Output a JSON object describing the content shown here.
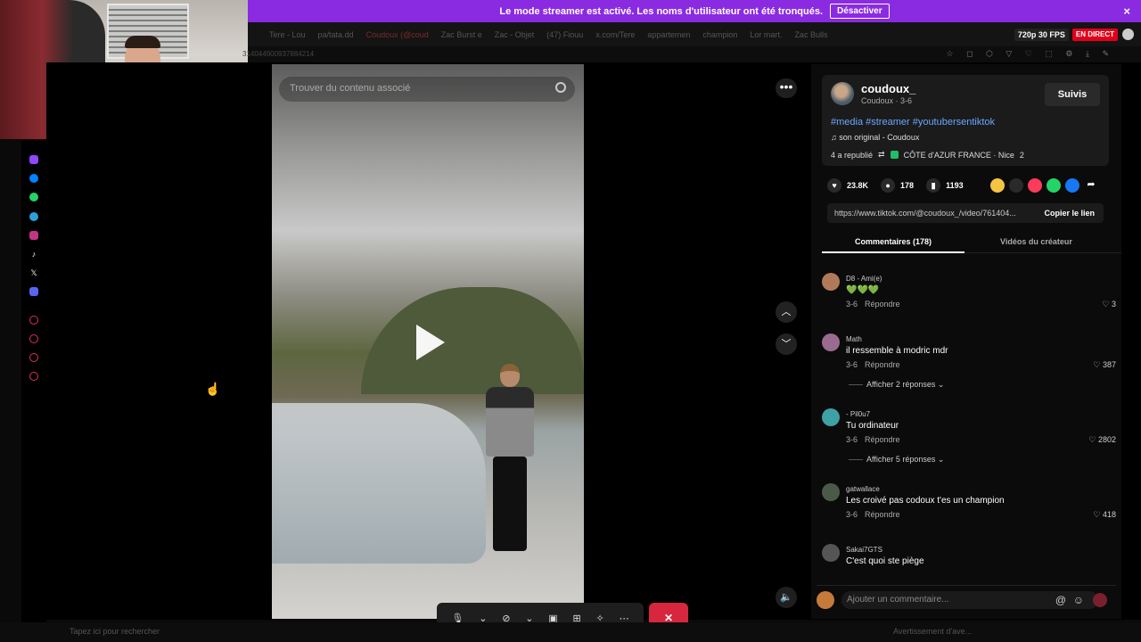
{
  "banner": {
    "message": "Le mode streamer est activé. Les noms d'utilisateur ont été tronqués.",
    "disable_label": "Désactiver",
    "close": "×"
  },
  "stream": {
    "resolution": "720p 30 FPS",
    "live_label": "EN DIRECT"
  },
  "browser": {
    "tabs": [
      "Tere - Lou",
      "pa/tata.dd",
      "Coudoux (@coud",
      "Zac Burst e",
      "Zac - Objet",
      "(47) Fiouu",
      "x.com/Tere",
      "appartemen",
      "champion",
      "Lor mart.",
      "Zac Bulls"
    ],
    "url_fragment": "314044900937884214"
  },
  "video": {
    "search_placeholder": "Trouver du contenu associé"
  },
  "post": {
    "username": "coudoux_",
    "display": "Coudoux · 3-6",
    "follow_label": "Suivis",
    "hashtags": "#media #streamer #youtubersentiktok",
    "music": "son original - Coudoux",
    "reposts": "4 a republié",
    "location": "CÔTE d'AZUR FRANCE · Nice",
    "location_more": "2",
    "likes": "23.8K",
    "comments": "178",
    "saves": "1193",
    "link": "https://www.tiktok.com/@coudoux_/video/761404...",
    "copy_label": "Copier le lien",
    "share_colors": [
      "#f5c542",
      "#2a2a2a",
      "#ff3b5c",
      "#25d366",
      "#1877f2"
    ]
  },
  "comment_tabs": {
    "comments": "Commentaires (178)",
    "creator_videos": "Vidéos du créateur"
  },
  "comments": [
    {
      "name": "D8 - Ami(e)",
      "text": "💚💚💚",
      "date": "3-6",
      "reply": "Répondre",
      "likes": "3",
      "avatar_color": "#b07a5a",
      "replies": ""
    },
    {
      "name": "Math",
      "text": "il ressemble à modric mdr",
      "date": "3-6",
      "reply": "Répondre",
      "likes": "387",
      "avatar_color": "#9a6b8e",
      "replies": "Afficher 2 réponses"
    },
    {
      "name": "- Pil0u7",
      "text": "Tu ordinateur",
      "date": "3-6",
      "reply": "Répondre",
      "likes": "2802",
      "avatar_color": "#3fa0a5",
      "replies": "Afficher 5 réponses"
    },
    {
      "name": "gatwallace",
      "text": "Les croivé pas codoux t'es un champion",
      "date": "3-6",
      "reply": "Répondre",
      "likes": "418",
      "avatar_color": "#4a5a4a",
      "replies": ""
    },
    {
      "name": "Sakai7GTS",
      "text": "C'est quoi ste piège",
      "date": "",
      "reply": "",
      "likes": "",
      "avatar_color": "#555",
      "replies": ""
    }
  ],
  "add_comment_placeholder": "Ajouter un commentaire...",
  "taskbar": {
    "search": "Tapez ici pour rechercher",
    "weather": "Avertissement d'ave..."
  }
}
